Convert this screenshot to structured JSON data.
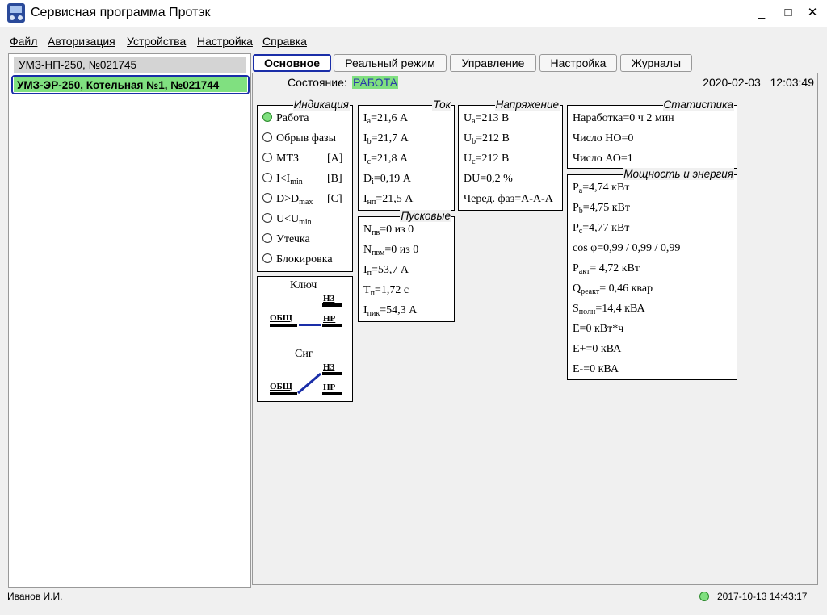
{
  "window": {
    "title": "Сервисная программа Протэк",
    "minimize": "_",
    "maximize": "□",
    "close": "✕"
  },
  "menu": [
    "Файл",
    "Авторизация",
    "Устройства",
    "Настройка",
    "Справка"
  ],
  "devices": [
    {
      "label": "УМЗ-НП-250, №021745"
    },
    {
      "label": "УМЗ-ЭР-250, Котельная №1, №021744",
      "selected": true,
      "color": "#80e080"
    }
  ],
  "tabs": [
    "Основное",
    "Реальный режим",
    "Управление",
    "Настройка",
    "Журналы"
  ],
  "status": {
    "label": "Состояние:",
    "value": "РАБОТА",
    "date": "2020-02-03",
    "time": "12:03:49"
  },
  "indication": {
    "title": "Индикация",
    "items": [
      {
        "text": "Работа",
        "on": true
      },
      {
        "text": "Обрыв фазы",
        "on": false
      },
      {
        "text": "МТЗ",
        "tag": "[A]",
        "on": false
      },
      {
        "text": "I<I",
        "sub": "min",
        "tag": "[B]",
        "on": false
      },
      {
        "text": "D>D",
        "sub": "max",
        "tag": "[C]",
        "on": false
      },
      {
        "text": "U<U",
        "sub": "min",
        "on": false
      },
      {
        "text": "Утечка",
        "on": false
      },
      {
        "text": "Блокировка",
        "on": false
      }
    ]
  },
  "switches": {
    "key_label": "Ключ",
    "sig_label": "Сиг",
    "common": "ОБЩ",
    "nc": "НЗ",
    "no": "НР"
  },
  "current": {
    "title": "Ток",
    "rows": [
      {
        "sym": "I",
        "sub": "a",
        "val": "=21,6 А"
      },
      {
        "sym": "I",
        "sub": "b",
        "val": "=21,7 А"
      },
      {
        "sym": "I",
        "sub": "c",
        "val": "=21,8 А"
      },
      {
        "sym": "D",
        "sub": "i",
        "val": "=0,19 А"
      },
      {
        "sym": "I",
        "sub": "нп",
        "val": "=21,5 А"
      }
    ]
  },
  "voltage": {
    "title": "Напряжение",
    "rows": [
      {
        "sym": "U",
        "sub": "a",
        "val": "=213 В"
      },
      {
        "sym": "U",
        "sub": "b",
        "val": "=212 В"
      },
      {
        "sym": "U",
        "sub": "c",
        "val": "=212 В"
      },
      {
        "sym": "DU",
        "sub": "",
        "val": "=0,2 %"
      },
      {
        "sym": "Черед. фаз",
        "sub": "",
        "val": "=A-A-A"
      }
    ]
  },
  "startup": {
    "title": "Пусковые",
    "rows": [
      {
        "sym": "N",
        "sub": "пв",
        "val": "=0 из 0"
      },
      {
        "sym": "N",
        "sub": "пвм",
        "val": "=0 из 0"
      },
      {
        "sym": "I",
        "sub": "п",
        "val": "=53,7 А"
      },
      {
        "sym": "T",
        "sub": "п",
        "val": "=1,72 с"
      },
      {
        "sym": "I",
        "sub": "пик",
        "val": "=54,3 А"
      }
    ]
  },
  "stats": {
    "title": "Статистика",
    "rows": [
      "Наработка=0 ч 2 мин",
      "Число НО=0",
      "Число АО=1"
    ]
  },
  "power": {
    "title": "Мощность и энергия",
    "rows": [
      {
        "sym": "P",
        "sub": "a",
        "val": "=4,74 кВт"
      },
      {
        "sym": "P",
        "sub": "b",
        "val": "=4,75 кВт"
      },
      {
        "sym": "P",
        "sub": "c",
        "val": "=4,77 кВт"
      },
      {
        "sym": "cos φ=0,99 / 0,99 / 0,99",
        "sub": "",
        "val": ""
      },
      {
        "sym": "P",
        "sub": "акт",
        "val": "= 4,72 кВт"
      },
      {
        "sym": "Q",
        "sub": "реакт",
        "val": "= 0,46 квар"
      },
      {
        "sym": "S",
        "sub": "полн",
        "val": "=14,4 кВА"
      },
      {
        "sym": "E=0 кВт*ч",
        "sub": "",
        "val": ""
      },
      {
        "sym": "E+=0 кВА",
        "sub": "",
        "val": ""
      },
      {
        "sym": "E-=0 кВА",
        "sub": "",
        "val": ""
      }
    ]
  },
  "footer": {
    "user": "Иванов И.И.",
    "datetime": "2017-10-13 14:43:17"
  }
}
